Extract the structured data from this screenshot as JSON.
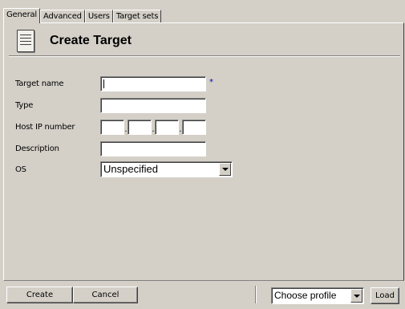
{
  "tabs": [
    {
      "label": "General",
      "active": true
    },
    {
      "label": "Advanced",
      "active": false
    },
    {
      "label": "Users",
      "active": false
    },
    {
      "label": "Target sets",
      "active": false
    }
  ],
  "header": {
    "title": "Create Target",
    "icon": "document-icon"
  },
  "form": {
    "target_name": {
      "label": "Target name",
      "value": "",
      "required_marker": "*"
    },
    "type": {
      "label": "Type",
      "value": ""
    },
    "host_ip": {
      "label": "Host IP number",
      "octets": [
        "",
        "",
        "",
        ""
      ],
      "separator": "."
    },
    "description": {
      "label": "Description",
      "value": ""
    },
    "os": {
      "label": "OS",
      "selected": "Unspecified"
    }
  },
  "footer": {
    "create_label": "Create",
    "cancel_label": "Cancel",
    "profile_selected": "Choose profile",
    "load_label": "Load"
  },
  "colors": {
    "background": "#d4d0c8",
    "required_marker": "#0000c0"
  }
}
